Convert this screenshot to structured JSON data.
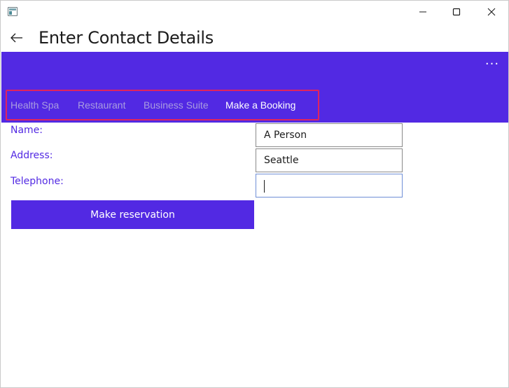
{
  "window": {
    "icon": "app-window-icon",
    "controls": {
      "minimize_icon": "minimize-icon",
      "maximize_icon": "maximize-icon",
      "close_icon": "close-icon"
    }
  },
  "header": {
    "back_icon": "back-arrow-icon",
    "title": "Enter Contact Details"
  },
  "command_bar": {
    "color": "#5229e3",
    "more_label": "···"
  },
  "tabs": [
    {
      "label": "Health Spa",
      "active": false
    },
    {
      "label": "Restaurant",
      "active": false
    },
    {
      "label": "Business Suite",
      "active": false
    },
    {
      "label": "Make a Booking",
      "active": true
    }
  ],
  "highlight_color": "#e0245e",
  "form": {
    "name_label": "Name:",
    "name_value": "A Person",
    "address_label": "Address:",
    "address_value": "Seattle",
    "telephone_label": "Telephone:",
    "telephone_value": "",
    "submit_label": "Make reservation"
  }
}
